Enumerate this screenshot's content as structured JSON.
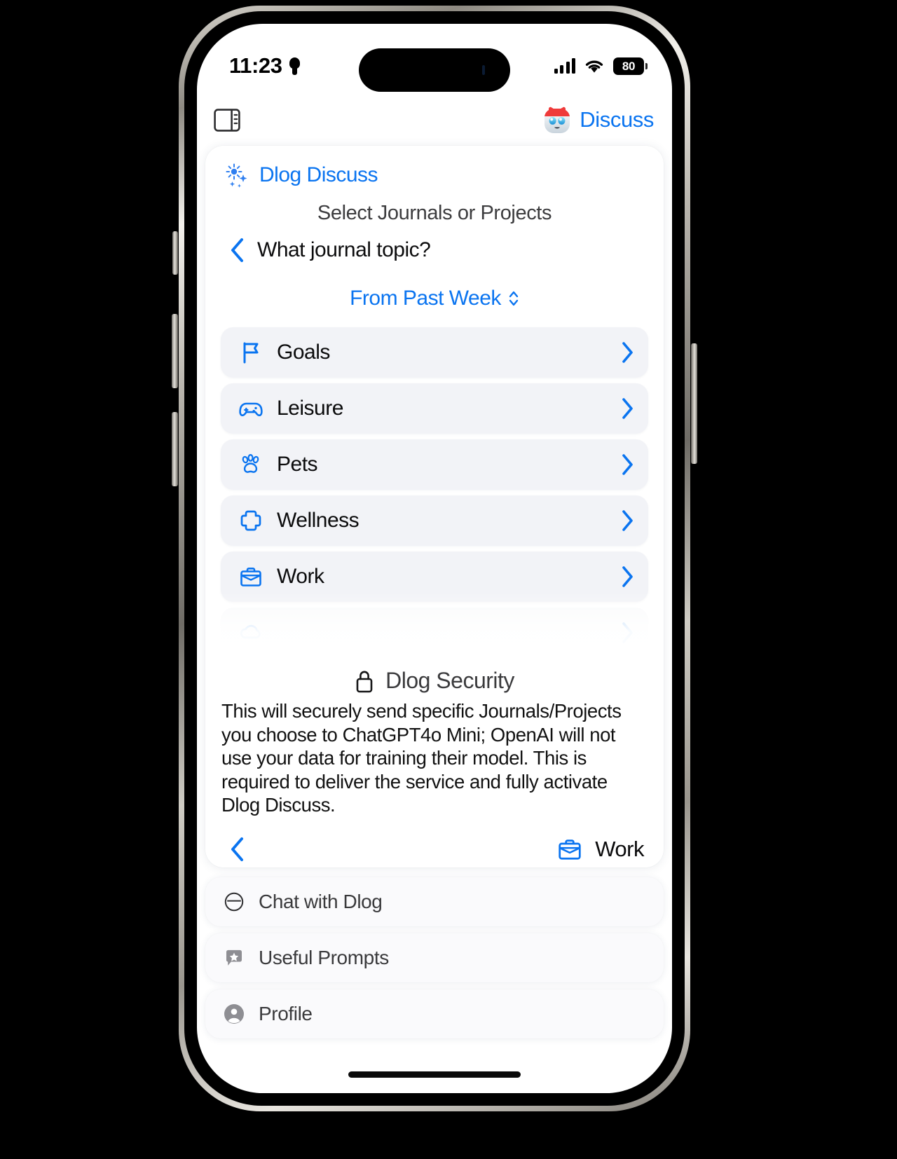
{
  "statusbar": {
    "time": "11:23",
    "bulb_icon": "lightbulb-icon",
    "signal_icon": "cellular-signal-icon",
    "wifi_icon": "wifi-icon",
    "battery_level": "80"
  },
  "navbar": {
    "sidebar_toggle_icon": "sidebar-toggle-icon",
    "avatar_icon": "dlog-avatar-icon",
    "label": "Discuss"
  },
  "card": {
    "header_icon": "sparkles-icon",
    "header_title": "Dlog Discuss",
    "subtitle": "Select Journals or Projects",
    "back_icon": "chevron-left-icon",
    "back_label": "What journal topic?",
    "range_label": "From Past Week",
    "range_icon": "up-down-chevron-icon",
    "items": [
      {
        "icon": "flag-icon",
        "label": "Goals",
        "chevron": "chevron-right-icon"
      },
      {
        "icon": "gamepad-icon",
        "label": "Leisure",
        "chevron": "chevron-right-icon"
      },
      {
        "icon": "paw-icon",
        "label": "Pets",
        "chevron": "chevron-right-icon"
      },
      {
        "icon": "cross-icon",
        "label": "Wellness",
        "chevron": "chevron-right-icon"
      },
      {
        "icon": "briefcase-icon",
        "label": "Work",
        "chevron": "chevron-right-icon"
      },
      {
        "icon": "cloud-icon",
        "label": "",
        "chevron": "chevron-right-icon"
      }
    ],
    "security": {
      "icon": "lock-icon",
      "title": "Dlog Security",
      "body": "This will securely send specific Journals/Projects you choose to ChatGPT4o Mini; OpenAI will not use your data for training their model. This is required to deliver the service and fully activate Dlog Discuss."
    },
    "footer": {
      "back_icon": "chevron-left-icon",
      "selected_icon": "briefcase-icon",
      "selected_label": "Work"
    }
  },
  "menu": {
    "items": [
      {
        "icon": "chat-circle-icon",
        "label": "Chat with Dlog"
      },
      {
        "icon": "star-bubble-icon",
        "label": "Useful Prompts"
      },
      {
        "icon": "person-circle-icon",
        "label": "Profile"
      }
    ]
  },
  "colors": {
    "accent_blue": "#0a74f0",
    "list_bg": "#f2f3f7",
    "avatar_cap": "#ef3b3b",
    "avatar_eye": "#27b6e8"
  }
}
